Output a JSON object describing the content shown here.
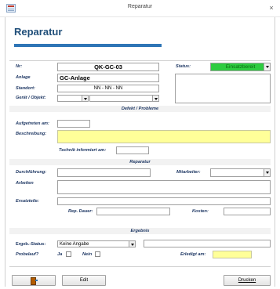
{
  "window": {
    "title": "Reparatur",
    "close_glyph": "×",
    "app_icon": "form-icon"
  },
  "form": {
    "heading": "Reparatur",
    "header": {
      "nr_label": "Nr:",
      "nr_value": "QK-GC-03",
      "anlage_label": "Anlage",
      "anlage_value": "GC-Anlage",
      "standort_label": "Standort:",
      "standort_value": "NN - NN - NN",
      "geraet_label": "Gerät / Objekt:",
      "geraet_value": "",
      "geraet2_value": "",
      "status_label": "Status:",
      "status_value": "Einsatzbereit",
      "status_color": "#2ecc40",
      "notes_value": ""
    },
    "defekt": {
      "section_title": "Defekt / Probleme",
      "aufgetreten_label": "Aufgetreten am:",
      "aufgetreten_value": "",
      "beschreibung_label": "Beschreibung:",
      "beschreibung_value": "",
      "technik_label": "Technik informiert am:",
      "technik_value": ""
    },
    "reparatur": {
      "section_title": "Reparatur",
      "durchfuehrung_label": "Durchführung:",
      "durchfuehrung_value": "",
      "mitarbeiter_label": "Mitarbeiter:",
      "mitarbeiter_value": "",
      "arbeiten_label": "Arbeiten",
      "arbeiten_value": "",
      "ersatzteile_label": "Ersatzteile:",
      "ersatzteile_value": "",
      "dauer_label": "Rep. Dauer:",
      "dauer_value": "",
      "kosten_label": "Kosten:",
      "kosten_value": ""
    },
    "ergebnis": {
      "section_title": "Ergebnis",
      "status_label": "Ergeb.-Status:",
      "status_value": "Keine Angabe",
      "status_extra": "",
      "probelauf_label": "Probelauf?",
      "ja_label": "Ja",
      "nein_label": "Nein",
      "erledigt_label": "Erledigt am:",
      "erledigt_value": ""
    }
  },
  "buttons": {
    "exit_icon": "exit-door-icon",
    "edit_label": "Edit",
    "print_label": "Drucken"
  },
  "colors": {
    "accent": "#2e75b6",
    "label": "#1f3864",
    "highlight": "#ffff99"
  }
}
